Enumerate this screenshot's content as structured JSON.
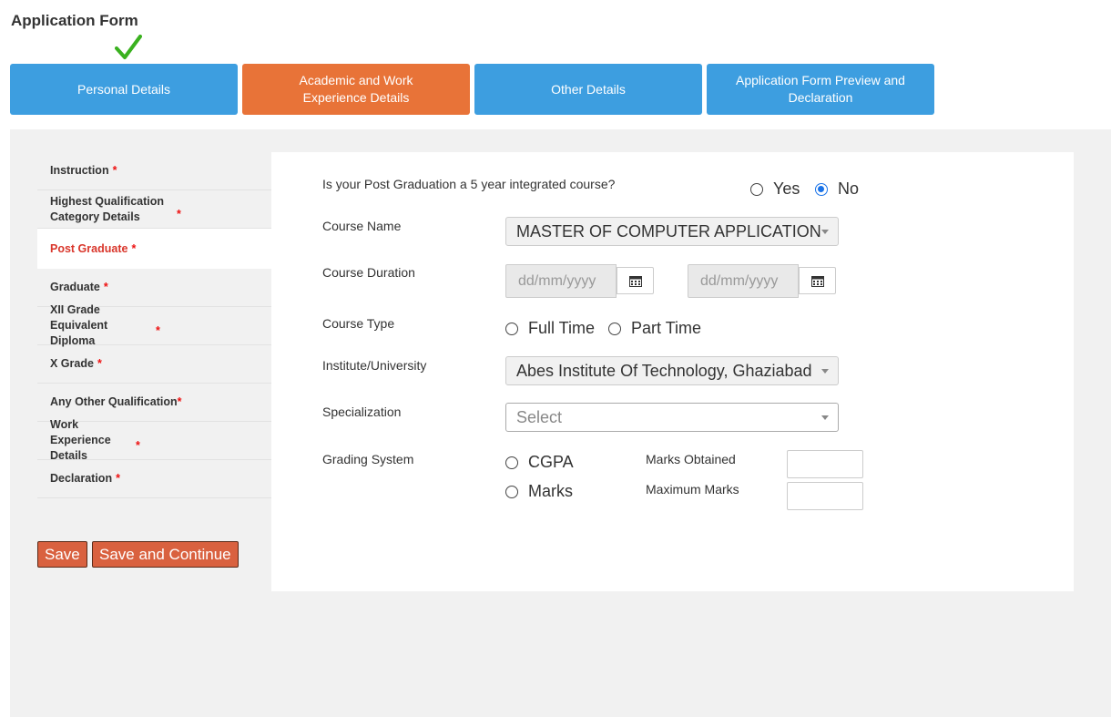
{
  "page": {
    "title": "Application Form"
  },
  "steps": [
    {
      "label": "Personal Details",
      "completed": true
    },
    {
      "label": "Academic and Work Experience Details",
      "active": true
    },
    {
      "label": "Other Details"
    },
    {
      "label": "Application Form Preview and Declaration"
    }
  ],
  "sidebar": {
    "items": [
      {
        "label": "Instruction",
        "required": "*"
      },
      {
        "label": "Highest Qualification Category Details",
        "required": "*"
      },
      {
        "label": "Post Graduate",
        "required": "*",
        "active": true
      },
      {
        "label": "Graduate",
        "required": "*"
      },
      {
        "label": "XII Grade Equivalent Diploma",
        "required": "*"
      },
      {
        "label": "X Grade",
        "required": "*"
      },
      {
        "label": "Any Other Qualification",
        "required": "*"
      },
      {
        "label": "Work Experience Details",
        "required": "*"
      },
      {
        "label": "Declaration",
        "required": "*"
      }
    ]
  },
  "actions": {
    "save_label": "Save",
    "save_continue_label": "Save and Continue"
  },
  "form": {
    "integrated_question": "Is your Post Graduation a 5 year integrated course?",
    "integrated_options": {
      "yes": "Yes",
      "no": "No",
      "selected": "No"
    },
    "course_name_label": "Course Name",
    "course_name_value": "MASTER OF COMPUTER APPLICATION",
    "course_duration_label": "Course Duration",
    "date_placeholder": "dd/mm/yyyy",
    "course_type_label": "Course Type",
    "course_type_options": {
      "full_time": "Full Time",
      "part_time": "Part Time"
    },
    "institute_label": "Institute/University",
    "institute_value": "Abes Institute Of Technology, Ghaziabad",
    "specialization_label": "Specialization",
    "specialization_value": "Select",
    "grading_label": "Grading System",
    "grading_options": {
      "cgpa": "CGPA",
      "marks": "Marks"
    },
    "marks_obtained_label": "Marks Obtained",
    "maximum_marks_label": "Maximum Marks"
  },
  "colors": {
    "step_blue": "#3d9ee0",
    "step_active": "#e87338",
    "accent_red": "#d9362b",
    "button": "#d9613f",
    "check_green": "#3ab11f"
  }
}
